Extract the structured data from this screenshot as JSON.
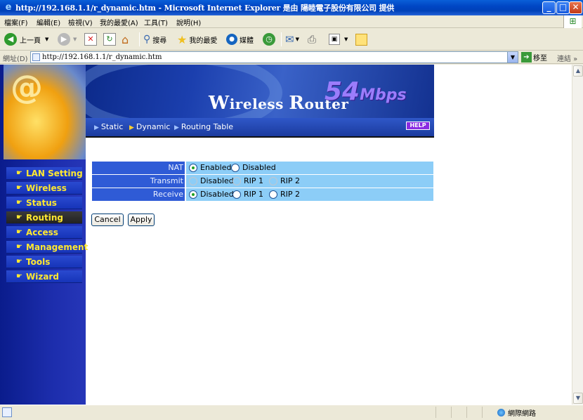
{
  "window": {
    "title": "http://192.168.1.1/r_dynamic.htm - Microsoft Internet Explorer 是由 陽睦電子股份有限公司 提供",
    "minimize": "_",
    "maximize": "□",
    "close": "✕"
  },
  "menu": {
    "file": "檔案(F)",
    "edit": "編輯(E)",
    "view": "檢視(V)",
    "favorites": "我的最愛(A)",
    "tools": "工具(T)",
    "help": "說明(H)"
  },
  "toolbar": {
    "back": "上一頁",
    "search": "搜尋",
    "favorites": "我的最愛",
    "media": "媒體"
  },
  "address": {
    "label": "網址(D)",
    "url": "http://192.168.1.1/r_dynamic.htm",
    "go": "移至",
    "links": "連結"
  },
  "banner": {
    "brand_w": "W",
    "brand_ireless": "ireless ",
    "brand_r": "R",
    "brand_outer": "outer",
    "speed": "54",
    "speed_unit": "Mbps",
    "help": "HELP"
  },
  "tabs": [
    {
      "label": "Static"
    },
    {
      "label": "Dynamic"
    },
    {
      "label": "Routing Table"
    }
  ],
  "sidebar": {
    "logo_glyph": "@",
    "items": [
      {
        "label": "LAN Setting"
      },
      {
        "label": "Wireless"
      },
      {
        "label": "Status"
      },
      {
        "label": "Routing"
      },
      {
        "label": "Access"
      },
      {
        "label": "Management"
      },
      {
        "label": "Tools"
      },
      {
        "label": "Wizard"
      }
    ]
  },
  "form": {
    "nat": {
      "label": "NAT",
      "enabled": "Enabled",
      "disabled": "Disabled",
      "selected": "Enabled"
    },
    "transmit": {
      "label": "Transmit",
      "disabled": "Disabled",
      "rip1": "RIP 1",
      "rip2": "RIP 2",
      "state": "disabled"
    },
    "receive": {
      "label": "Receive",
      "disabled": "Disabled",
      "rip1": "RIP 1",
      "rip2": "RIP 2",
      "selected": "Disabled"
    }
  },
  "buttons": {
    "cancel": "Cancel",
    "apply": "Apply"
  },
  "status": {
    "zone": "網際網路"
  },
  "colors": {
    "label_bg": "#2f5bd6",
    "value_bg": "#8ccdf7",
    "nav_text": "#ffe830",
    "speed": "#9b7dfb"
  }
}
